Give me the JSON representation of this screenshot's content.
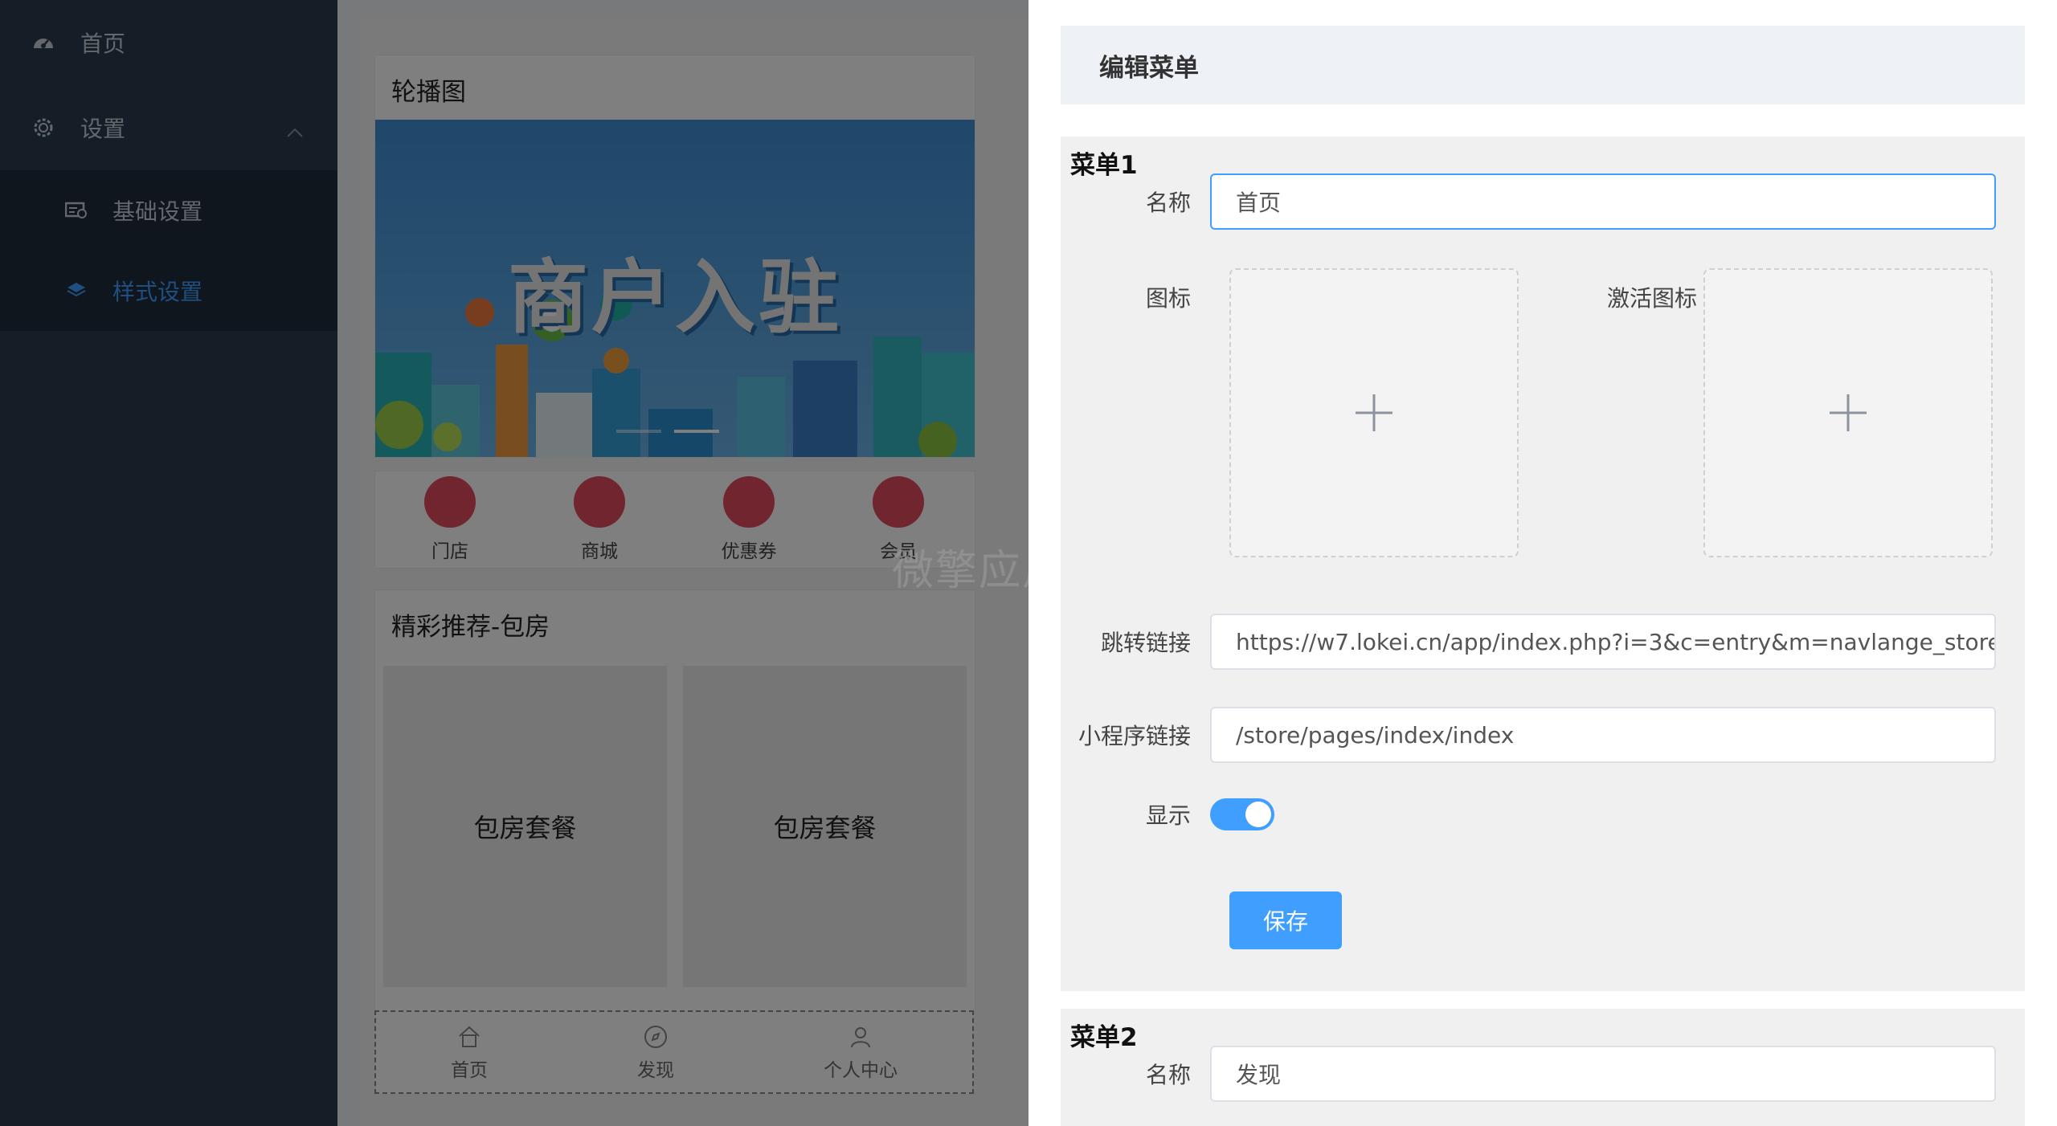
{
  "sidebar": {
    "items": [
      {
        "label": "首页",
        "icon": "dashboard-icon"
      },
      {
        "label": "设置",
        "icon": "gear-icon"
      }
    ],
    "submenu": [
      {
        "label": "基础设置",
        "icon": "settings-card-icon"
      },
      {
        "label": "样式设置",
        "icon": "layers-icon"
      }
    ],
    "active_color": "#409eff"
  },
  "preview": {
    "carousel_title": "轮播图",
    "banner_text": "商户入驻",
    "nav_icons": [
      "门店",
      "商城",
      "优惠券",
      "会员"
    ],
    "recommend_title": "精彩推荐-包房",
    "packages": [
      "包房套餐",
      "包房套餐"
    ],
    "tabbar": [
      {
        "label": "首页",
        "icon": "home-icon"
      },
      {
        "label": "发现",
        "icon": "compass-icon"
      },
      {
        "label": "个人中心",
        "icon": "user-icon"
      }
    ]
  },
  "watermark": "微擎应用商城",
  "drawer": {
    "title": "编辑菜单",
    "menu1": {
      "title": "菜单1",
      "name_label": "名称",
      "name_value": "首页",
      "icon_label": "图标",
      "active_icon_label": "激活图标",
      "link_label": "跳转链接",
      "link_value": "https://w7.lokei.cn/app/index.php?i=3&c=entry&m=navlange_store&do=index",
      "mini_link_label": "小程序链接",
      "mini_link_value": "/store/pages/index/index",
      "show_label": "显示",
      "show": true,
      "save_label": "保存"
    },
    "menu2": {
      "title": "菜单2",
      "name_label": "名称",
      "name_value": "发现"
    }
  }
}
